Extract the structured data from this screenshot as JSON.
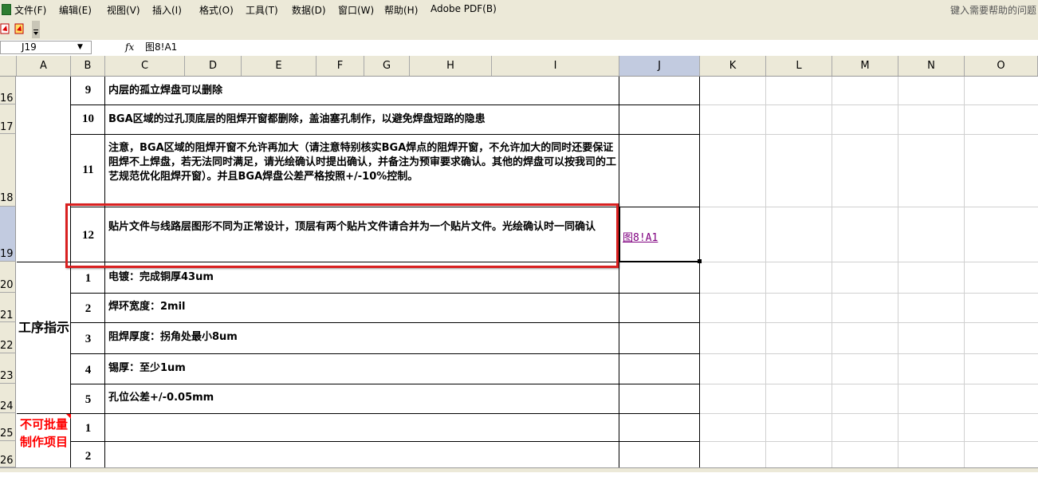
{
  "menu": {
    "items": [
      "文件(F)",
      "编辑(E)",
      "视图(V)",
      "插入(I)",
      "格式(O)",
      "工具(T)",
      "数据(D)",
      "窗口(W)",
      "帮助(H)",
      "Adobe PDF(B)"
    ],
    "help_placeholder": "键入需要帮助的问题"
  },
  "formula_bar": {
    "name_box": "J19",
    "fx_label": "fx",
    "content": "图8!A1"
  },
  "columns": [
    "A",
    "B",
    "C",
    "D",
    "E",
    "F",
    "G",
    "H",
    "I",
    "J",
    "K",
    "L",
    "M",
    "N",
    "O"
  ],
  "selected_column": "J",
  "rows": [
    "16",
    "17",
    "18",
    "19",
    "20",
    "21",
    "22",
    "23",
    "24",
    "25",
    "26"
  ],
  "selected_row": "19",
  "items": [
    {
      "num": "9",
      "text": "内层的孤立焊盘可以删除"
    },
    {
      "num": "10",
      "text": "BGA区域的过孔顶底层的阻焊开窗都删除，盖油塞孔制作，以避免焊盘短路的隐患"
    },
    {
      "num": "11",
      "text": "注意，BGA区域的阻焊开窗不允许再加大（请注意特别核实BGA焊点的阻焊开窗，不允许加大的同时还要保证阻焊不上焊盘，若无法同时满足，请光绘确认时提出确认，并备注为预审要求确认。其他的焊盘可以按我司的工艺规范优化阻焊开窗）。并且BGA焊盘公差严格按照+/-10%控制。"
    },
    {
      "num": "12",
      "text": "贴片文件与线路层图形不同为正常设计，顶层有两个贴片文件请合并为一个贴片文件。光绘确认时一同确认"
    }
  ],
  "link_text": "图8!A1",
  "section_process": {
    "label": "工序指示",
    "items": [
      {
        "num": "1",
        "text": "电镀：完成铜厚43um"
      },
      {
        "num": "2",
        "text": "焊环宽度：2mil"
      },
      {
        "num": "3",
        "text": "阻焊厚度：拐角处最小8um"
      },
      {
        "num": "4",
        "text": "锡厚：至少1um"
      },
      {
        "num": "5",
        "text": "孔位公差+/-0.05mm"
      }
    ]
  },
  "section_nobatch": {
    "label": "不可批量制作项目",
    "items": [
      {
        "num": "1",
        "text": ""
      },
      {
        "num": "2",
        "text": ""
      }
    ]
  },
  "colors": {
    "highlight": "#d92020",
    "selection": "#c2cbe0",
    "link": "#800080",
    "red_label": "#ff0000"
  }
}
